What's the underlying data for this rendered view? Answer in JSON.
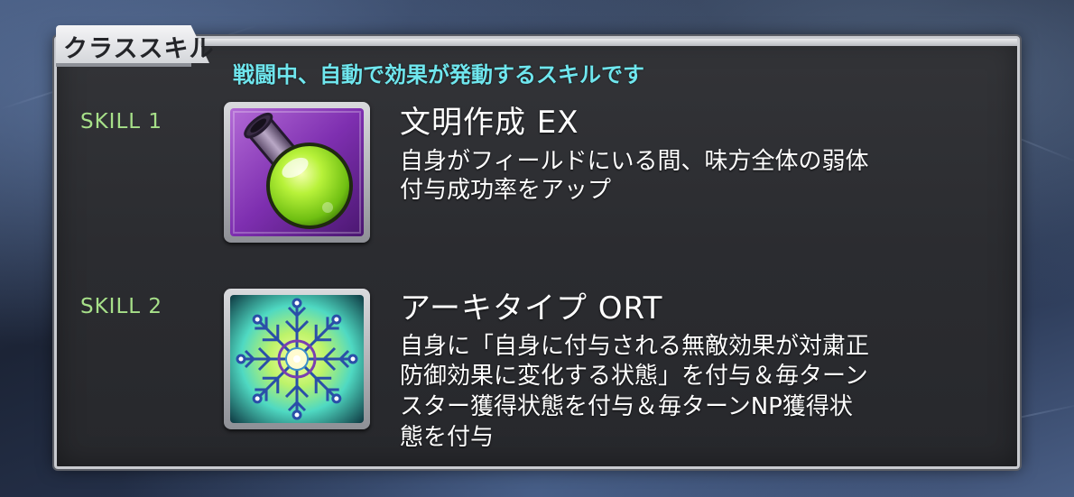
{
  "panel": {
    "title": "クラススキル",
    "subtitle": "戦闘中、自動で効果が発動するスキルです"
  },
  "skills": [
    {
      "label": "SKILL 1",
      "name": "文明作成 EX",
      "icon": "green-potion-flask-icon",
      "description_lines": [
        "自身がフィールドにいる間、味方全体の弱体",
        "付与成功率をアップ"
      ]
    },
    {
      "label": "SKILL 2",
      "name": "アーキタイプ ORT",
      "icon": "crystal-snowflake-icon",
      "description_lines": [
        "自身に「自身に付与される無敵効果が対粛正",
        "防御効果に変化する状態」を付与＆毎ターン",
        "スター獲得状態を付与＆毎ターンNP獲得状",
        "態を付与"
      ]
    }
  ],
  "colors": {
    "subtitle": "#6fe6ee",
    "skill_label": "#a7e089",
    "panel_bg": "#2b2c30",
    "text": "#ffffff"
  }
}
